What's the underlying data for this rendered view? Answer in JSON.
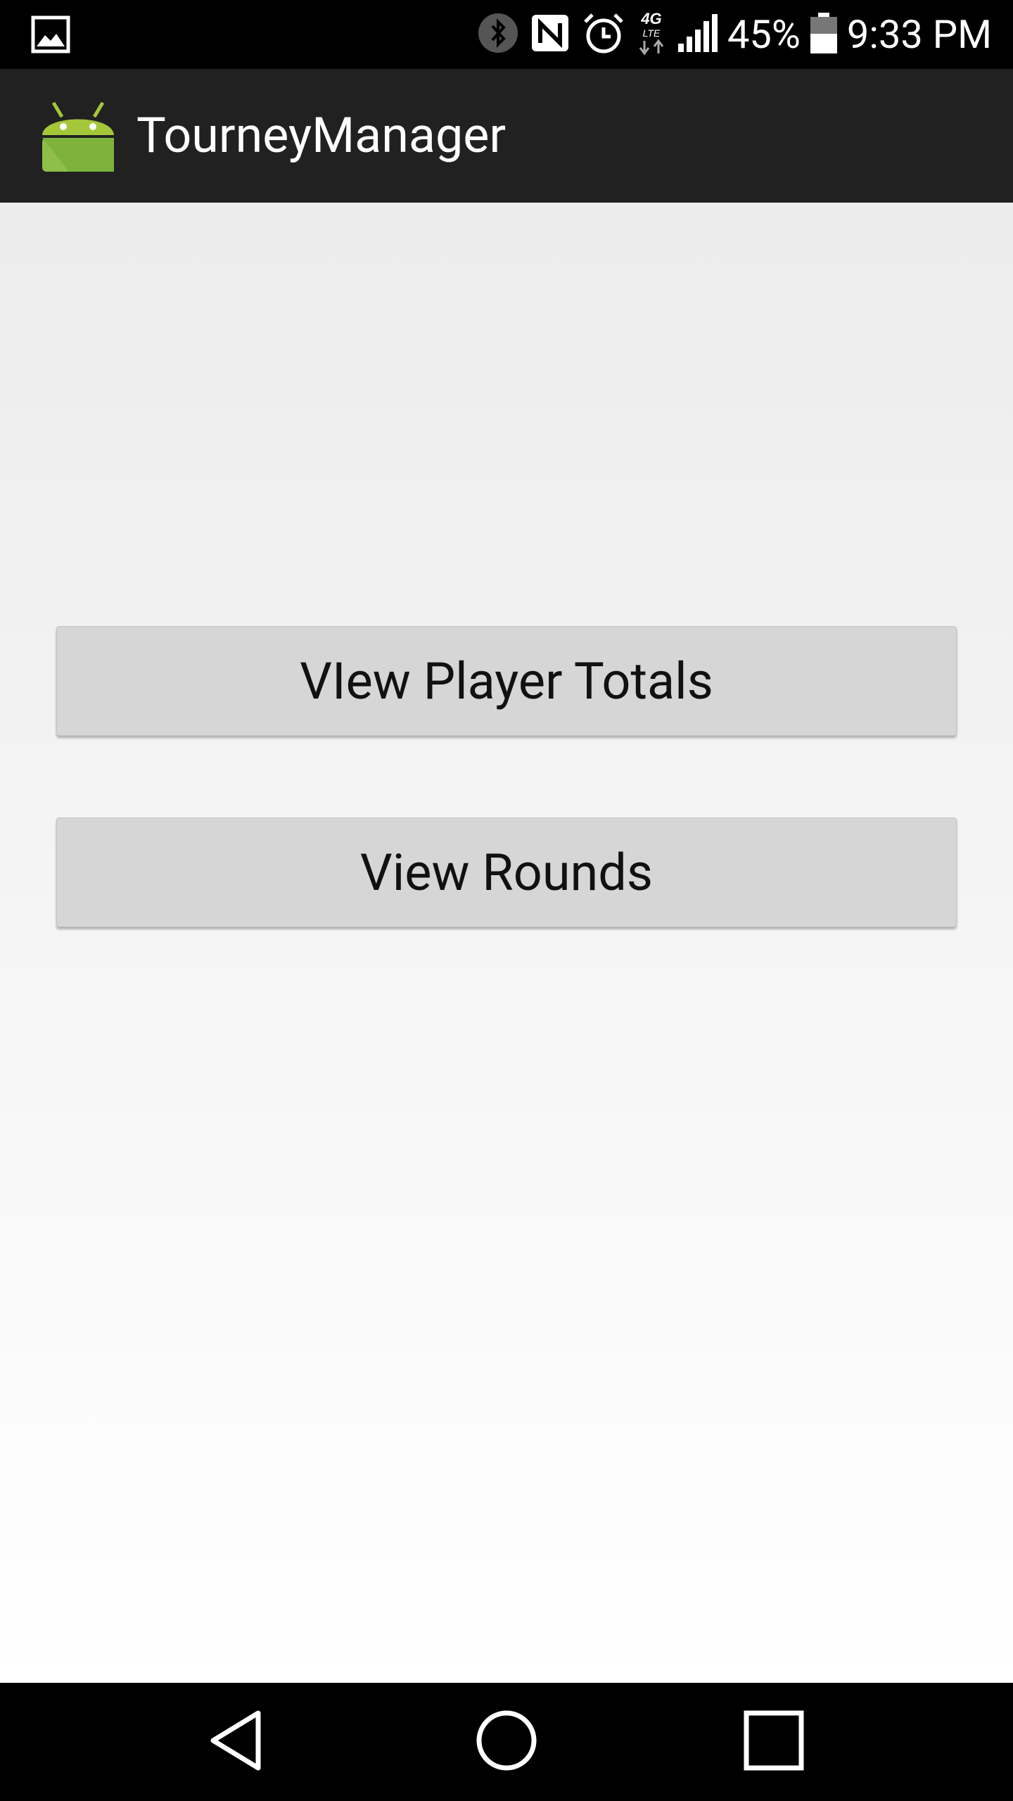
{
  "status_bar": {
    "battery_percent": "45%",
    "time": "9:33 PM",
    "network_label": "4G LTE",
    "icons": [
      "gallery-icon",
      "bluetooth-icon",
      "nfc-icon",
      "alarm-icon",
      "network-4g-lte-icon",
      "signal-icon",
      "battery-icon"
    ]
  },
  "app_bar": {
    "title": "TourneyManager",
    "icon": "android-icon",
    "background": "#212121"
  },
  "main": {
    "buttons": [
      {
        "label": "VIew Player Totals"
      },
      {
        "label": "View Rounds"
      }
    ],
    "button_color": "#d6d6d6"
  },
  "nav_bar": {
    "items": [
      {
        "icon": "back-icon"
      },
      {
        "icon": "home-icon"
      },
      {
        "icon": "recents-icon"
      }
    ]
  }
}
